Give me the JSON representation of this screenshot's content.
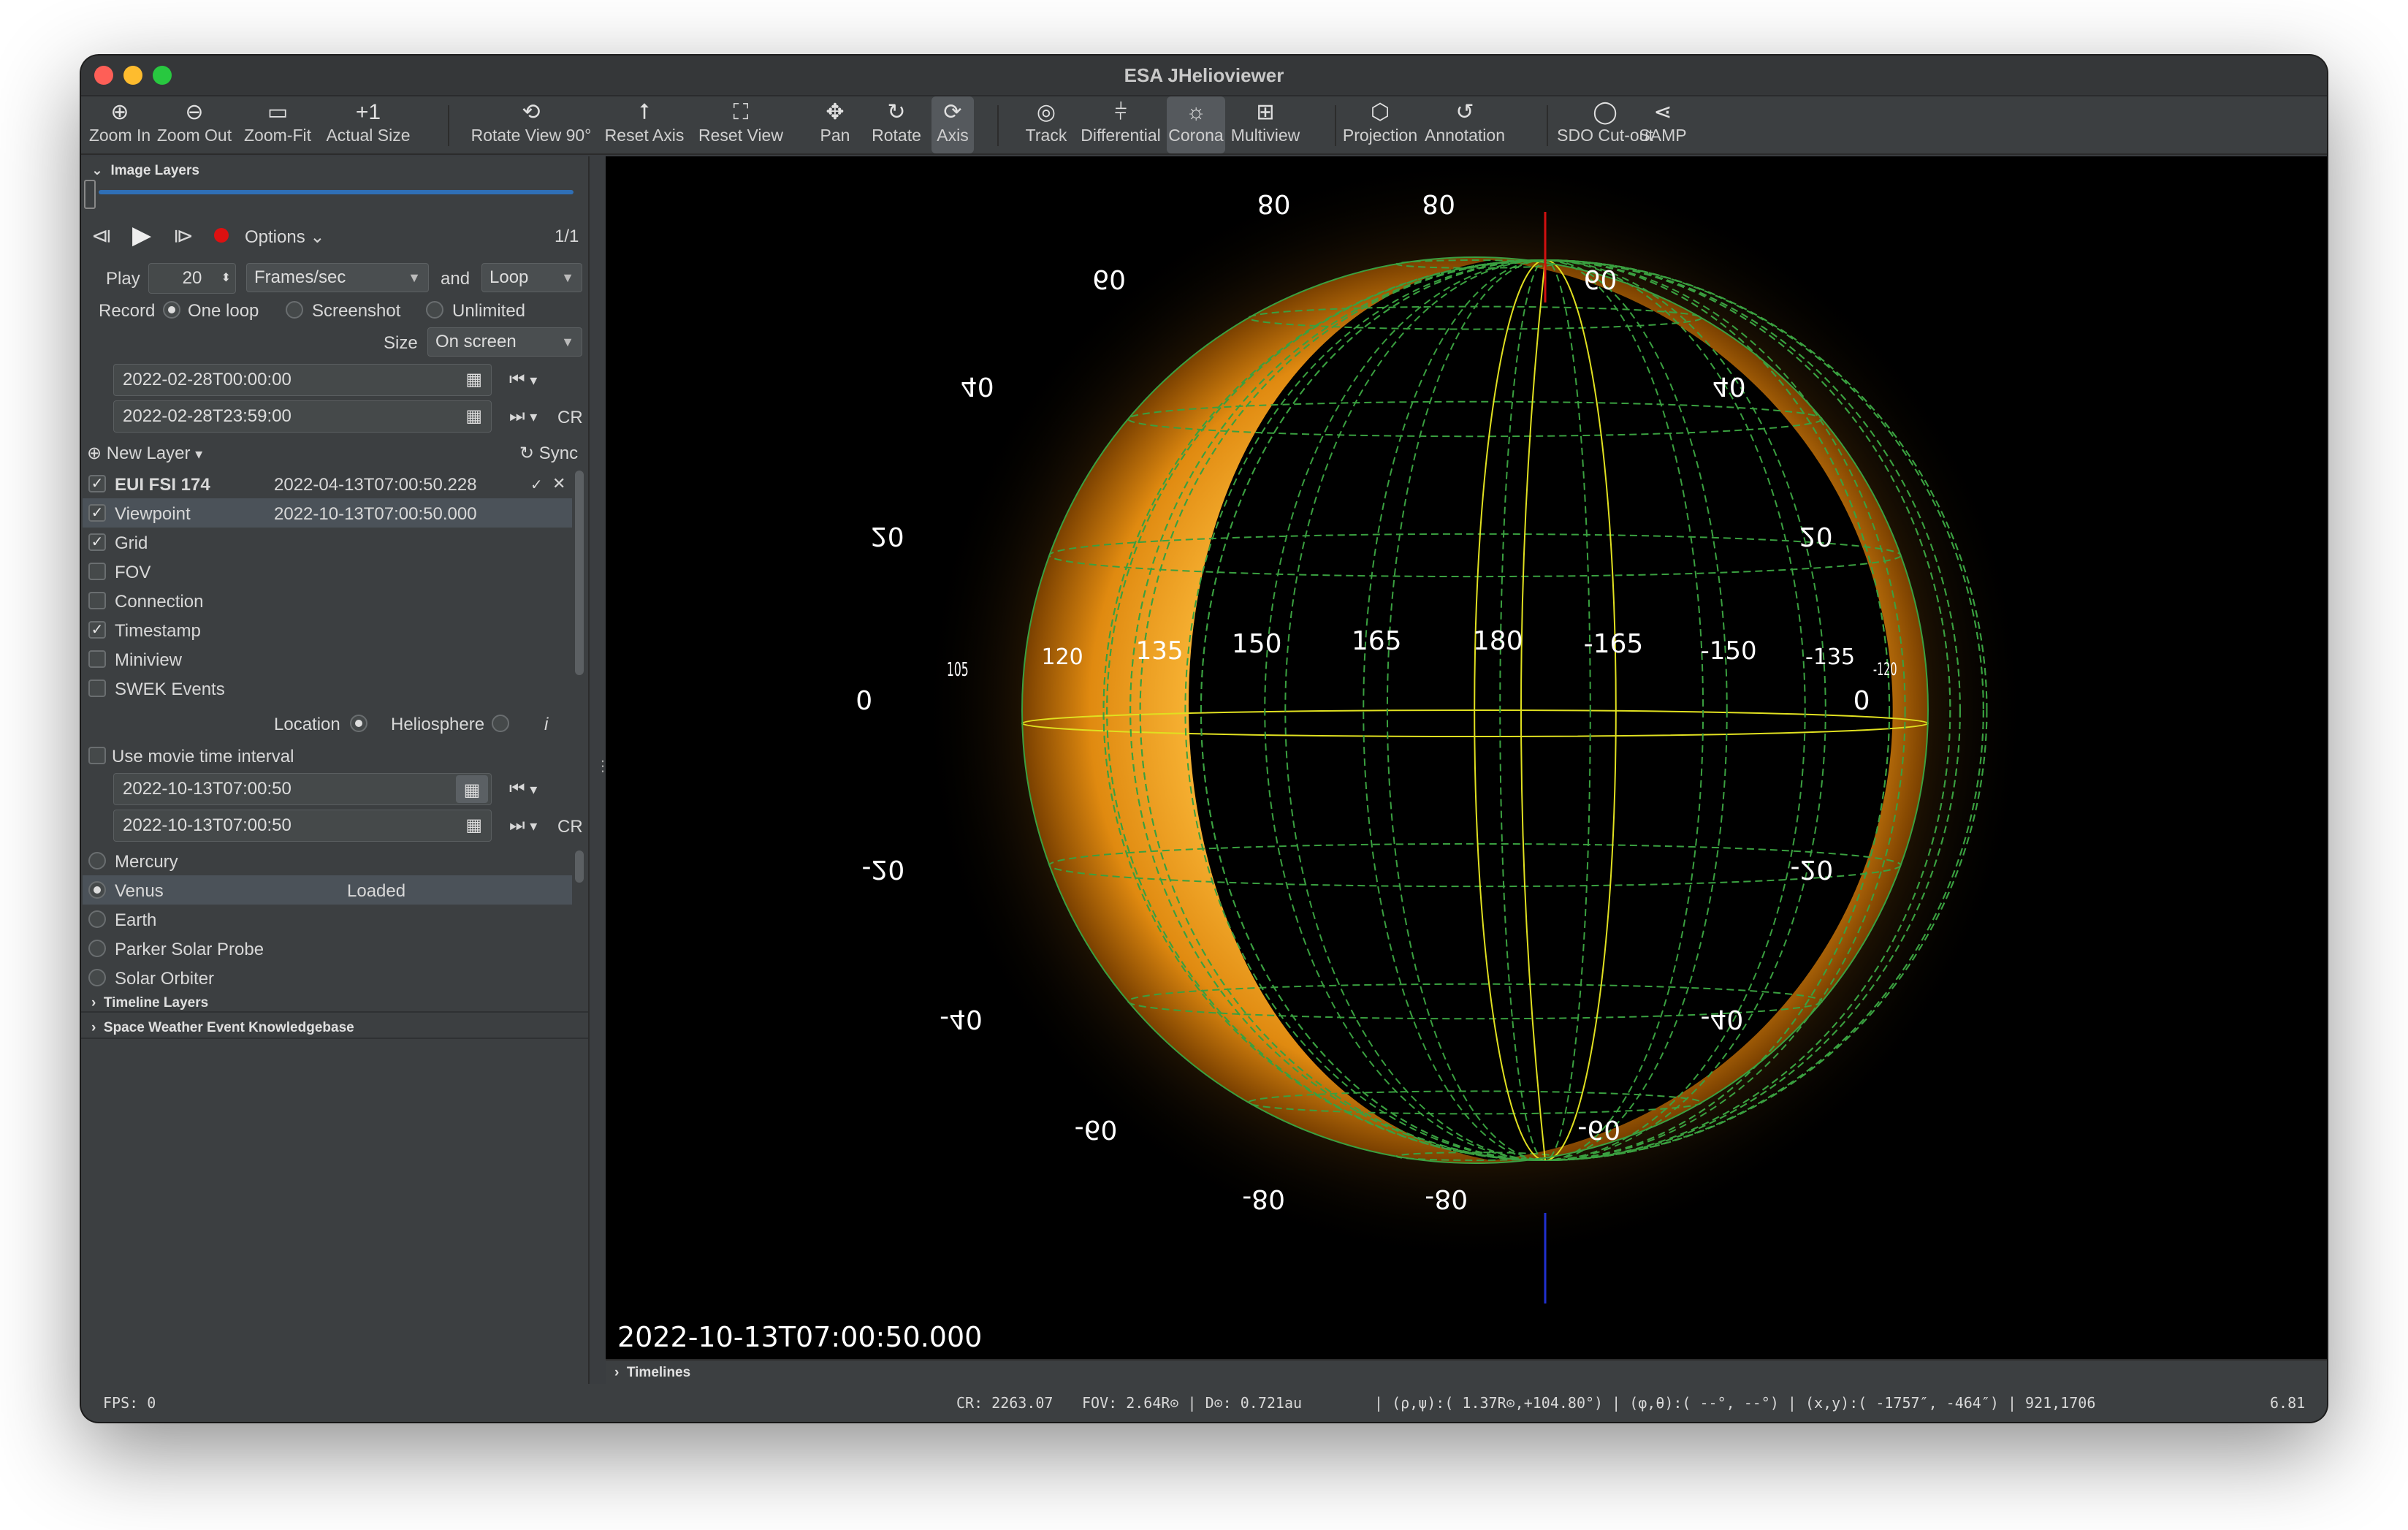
{
  "window": {
    "title": "ESA JHelioviewer"
  },
  "toolbar": [
    {
      "label": "Zoom In",
      "icon": "zoom-in-icon",
      "glyph": "⊕"
    },
    {
      "label": "Zoom Out",
      "icon": "zoom-out-icon",
      "glyph": "⊖"
    },
    {
      "label": "Zoom-Fit",
      "icon": "zoom-fit-icon",
      "glyph": "▭"
    },
    {
      "label": "Actual Size",
      "icon": "actual-size-icon",
      "glyph": "+1"
    },
    {
      "label": "Rotate View 90°",
      "icon": "rotate-view-icon",
      "glyph": "⟲"
    },
    {
      "label": "Reset Axis",
      "icon": "reset-axis-icon",
      "glyph": "⭡"
    },
    {
      "label": "Reset View",
      "icon": "reset-view-icon",
      "glyph": "⛶"
    },
    {
      "label": "Pan",
      "icon": "pan-icon",
      "glyph": "✥"
    },
    {
      "label": "Rotate",
      "icon": "rotate-icon",
      "glyph": "↻"
    },
    {
      "label": "Axis",
      "icon": "axis-icon",
      "glyph": "⟳"
    },
    {
      "label": "Track",
      "icon": "track-icon",
      "glyph": "◎"
    },
    {
      "label": "Differential",
      "icon": "differential-icon",
      "glyph": "⫩"
    },
    {
      "label": "Corona",
      "icon": "corona-icon",
      "glyph": "☼"
    },
    {
      "label": "Multiview",
      "icon": "multiview-icon",
      "glyph": "⊞"
    },
    {
      "label": "Projection",
      "icon": "projection-icon",
      "glyph": "⬡"
    },
    {
      "label": "Annotation",
      "icon": "annotation-icon",
      "glyph": "↺"
    },
    {
      "label": "SDO Cut-out",
      "icon": "sdo-cutout-icon",
      "glyph": "◯"
    },
    {
      "label": "SAMP",
      "icon": "samp-icon",
      "glyph": "⋖"
    }
  ],
  "image_layers": {
    "section_title": "Image Layers",
    "options_label": "Options",
    "frame_counter": "1/1",
    "play_label": "Play",
    "fps_value": "20",
    "fps_unit": "Frames/sec",
    "and_label": "and",
    "loop_mode": "Loop",
    "record_label": "Record",
    "record_options": [
      "One loop",
      "Screenshot",
      "Unlimited"
    ],
    "size_label": "Size",
    "size_value": "On screen",
    "start_time": "2022-02-28T00:00:00",
    "end_time": "2022-02-28T23:59:00",
    "cr_label": "CR",
    "new_layer_label": "New Layer",
    "sync_label": "Sync",
    "layers": [
      {
        "name": "EUI FSI 174",
        "time": "2022-04-13T07:00:50.228",
        "checked": true,
        "bold": true
      },
      {
        "name": "Viewpoint",
        "time": "2022-10-13T07:00:50.000",
        "checked": true,
        "selected": true
      },
      {
        "name": "Grid",
        "time": "",
        "checked": true
      },
      {
        "name": "FOV",
        "time": "",
        "checked": false
      },
      {
        "name": "Connection",
        "time": "",
        "checked": false
      },
      {
        "name": "Timestamp",
        "time": "",
        "checked": true
      },
      {
        "name": "Miniview",
        "time": "",
        "checked": false
      },
      {
        "name": "SWEK Events",
        "time": "",
        "checked": false
      }
    ],
    "location_label": "Location",
    "heliosphere_label": "Heliosphere",
    "info_glyph": "i",
    "movie_interval_label": "Use movie time interval",
    "vp_start": "2022-10-13T07:00:50",
    "vp_end": "2022-10-13T07:00:50",
    "objects": [
      {
        "name": "Mercury",
        "status": "",
        "selected": false
      },
      {
        "name": "Venus",
        "status": "Loaded",
        "selected": true
      },
      {
        "name": "Earth",
        "status": "",
        "selected": false
      },
      {
        "name": "Parker Solar Probe",
        "status": "",
        "selected": false
      },
      {
        "name": "Solar Orbiter",
        "status": "",
        "selected": false
      }
    ]
  },
  "timeline_layers": "Timeline Layers",
  "swek": "Space Weather Event Knowledgebase",
  "timelines": "Timelines",
  "viewer": {
    "timestamp": "2022-10-13T07:00:50.000",
    "lon_labels": [
      "105",
      "120",
      "135",
      "150",
      "165",
      "180",
      "-165",
      "-150",
      "-135",
      "-120"
    ],
    "lat_labels": [
      "80",
      "60",
      "40",
      "20",
      "0",
      "-20",
      "-40",
      "-60",
      "-80"
    ]
  },
  "status": {
    "fps": "FPS:  0",
    "cr": "CR: 2263.07",
    "fov": "FOV:   2.64R⊙ | D⊙:   0.721au",
    "rho": "| (ρ,ψ):(   1.37R⊙,+104.80°) | (φ,θ):(     --°,      --°) | (x,y):(  -1757″,   -464″) |  921,1706",
    "zoom": "6.81"
  }
}
